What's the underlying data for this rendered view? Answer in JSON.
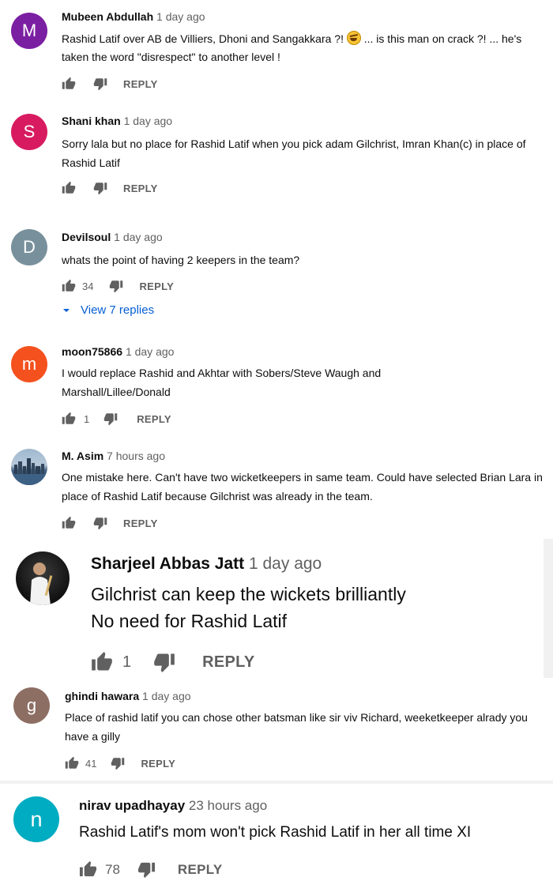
{
  "colors": {
    "avatar_m1": "#7b1fa2",
    "avatar_s": "#d81b60",
    "avatar_d": "#78909c",
    "avatar_m2": "#f4511e",
    "avatar_g": "#8d6e63",
    "avatar_n": "#00acc1",
    "link_blue": "#065fd4"
  },
  "comments": [
    {
      "avatar_letter": "M",
      "author": "Mubeen Abdullah",
      "time": "1 day ago",
      "text_before_emoji": "Rashid Latif over AB de Villiers, Dhoni and Sangakkara ?!",
      "emoji_icon": "rolling-on-floor-laughing-emoji",
      "text_after_emoji": "... is this man on crack ?! ... he's taken the word \"disrespect\" to another level !",
      "likes": "",
      "reply_label": "REPLY"
    },
    {
      "avatar_letter": "S",
      "author": "Shani khan",
      "time": "1 day ago",
      "text": "Sorry lala but no place for Rashid Latif when you pick adam Gilchrist, Imran Khan(c) in place of Rashid Latif",
      "likes": "",
      "reply_label": "REPLY"
    },
    {
      "avatar_letter": "D",
      "author": "Devilsoul",
      "time": "1 day ago",
      "text": "whats the point of having 2 keepers in the team?",
      "likes": "34",
      "reply_label": "REPLY",
      "view_replies": "View 7 replies"
    },
    {
      "avatar_letter": "m",
      "author": "moon75866",
      "time": "1 day ago",
      "text": "I would replace Rashid and Akhtar with Sobers/Steve Waugh and Marshall/Lillee/Donald",
      "likes": "1",
      "reply_label": "REPLY"
    },
    {
      "avatar_image": "city-skyline-photo",
      "author": "M. Asim",
      "time": "7 hours ago",
      "text": "One mistake here. Can't have two wicketkeepers in same team. Could have selected Brian Lara in place of Rashid Latif because Gilchrist was already in the team.",
      "likes": "",
      "reply_label": "REPLY"
    },
    {
      "avatar_image": "cricketer-photo",
      "author": "Sharjeel Abbas Jatt",
      "time": "1 day ago",
      "text": "Gilchrist can keep the wickets brilliantly\nNo need for Rashid Latif",
      "likes": "1",
      "reply_label": "REPLY"
    },
    {
      "avatar_letter": "g",
      "author": "ghindi hawara",
      "time": "1 day ago",
      "text": "Place of rashid latif you can chose other batsman like sir viv Richard, weeketkeeper alrady you have a gilly",
      "likes": "41",
      "reply_label": "REPLY"
    },
    {
      "avatar_letter": "n",
      "author": "nirav upadhayay",
      "time": "23 hours ago",
      "text": "Rashid Latif's mom won't pick Rashid Latif in her all time XI",
      "likes": "78",
      "reply_label": "REPLY"
    }
  ]
}
